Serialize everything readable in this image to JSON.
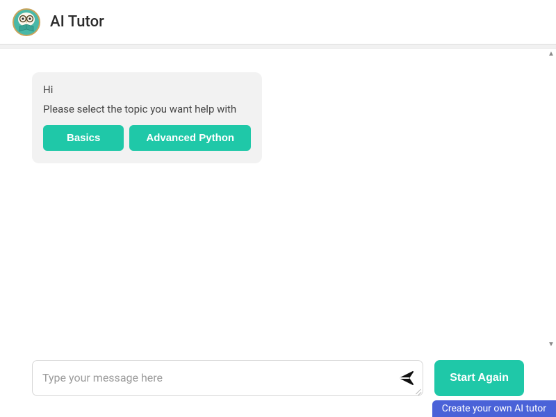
{
  "header": {
    "title": "AI Tutor"
  },
  "message": {
    "greeting": "Hi",
    "prompt": "Please select the topic you want help with",
    "topics": {
      "basics": "Basics",
      "advanced": "Advanced Python"
    }
  },
  "input": {
    "placeholder": "Type your message here"
  },
  "actions": {
    "start_again": "Start Again"
  },
  "footer": {
    "cta": "Create your own AI tutor"
  }
}
